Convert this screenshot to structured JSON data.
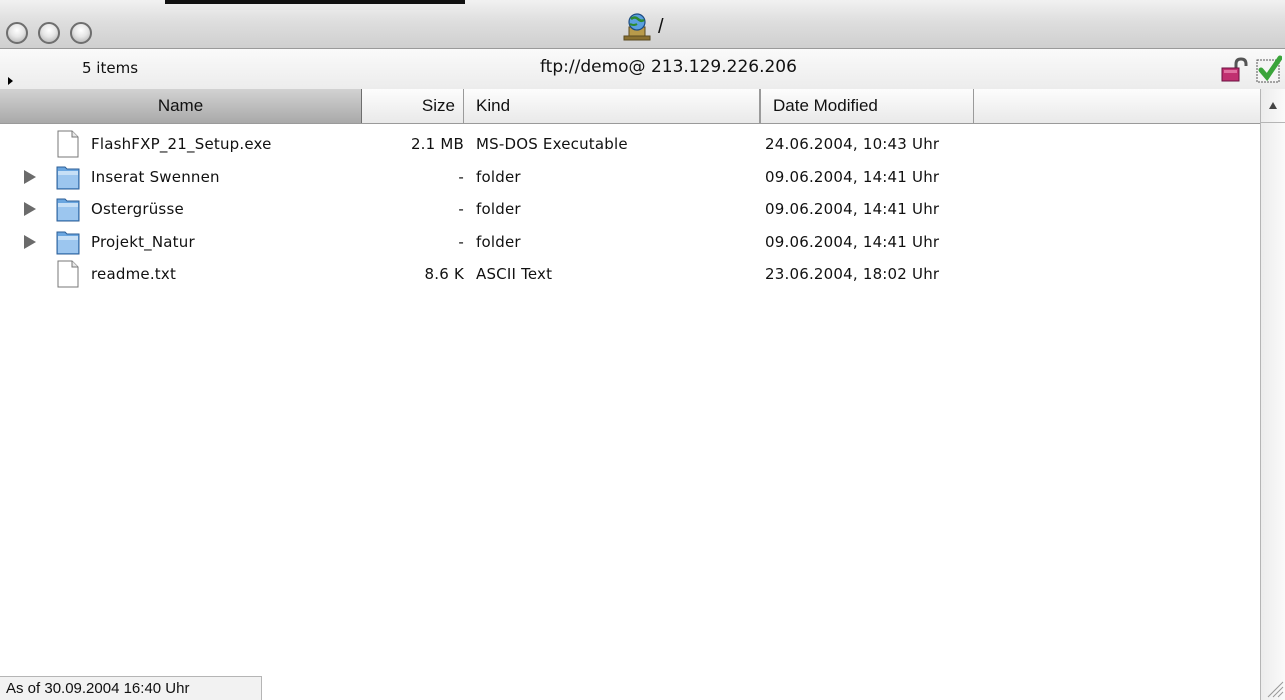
{
  "window": {
    "title": "/",
    "title_icon": "network-globe-icon"
  },
  "infobar": {
    "items_count": "5 items",
    "server": "ftp://demo@ 213.129.226.206",
    "lock_icon": "open-lock-icon",
    "check_icon": "checkmark-icon"
  },
  "columns": {
    "name": "Name",
    "size": "Size",
    "kind": "Kind",
    "date": "Date Modified"
  },
  "files": [
    {
      "name": "FlashFXP_21_Setup.exe",
      "size": "2.1 MB",
      "kind": "MS-DOS Executable",
      "date": "24.06.2004, 10:43 Uhr",
      "type": "file"
    },
    {
      "name": "Inserat Swennen",
      "size": "-",
      "kind": "folder",
      "date": "09.06.2004, 14:41 Uhr",
      "type": "folder"
    },
    {
      "name": "Ostergrüsse",
      "size": "-",
      "kind": "folder",
      "date": "09.06.2004, 14:41 Uhr",
      "type": "folder"
    },
    {
      "name": "Projekt_Natur",
      "size": "-",
      "kind": "folder",
      "date": "09.06.2004, 14:41 Uhr",
      "type": "folder"
    },
    {
      "name": "readme.txt",
      "size": "8.6 K",
      "kind": "ASCII Text",
      "date": "23.06.2004, 18:02 Uhr",
      "type": "file"
    }
  ],
  "status": {
    "text": "As of 30.09.2004 16:40 Uhr"
  },
  "colors": {
    "folder_blue": "#6aa6e0",
    "lock_magenta": "#c03070",
    "check_green": "#3aa43a"
  }
}
